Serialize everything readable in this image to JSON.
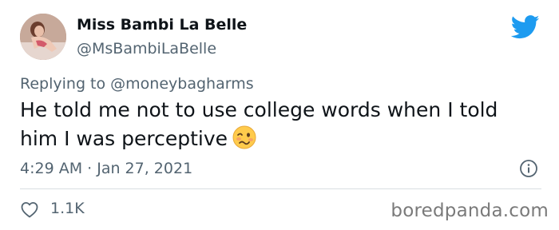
{
  "author": {
    "display_name": "Miss Bambi La Belle",
    "handle": "@MsBambiLaBelle"
  },
  "reply": {
    "prefix": "Replying to ",
    "mention": "@moneybagharms"
  },
  "tweet": {
    "text": "He told me not to use college words when I told him I was perceptive",
    "emoji": "woozy-face-icon"
  },
  "meta": {
    "timestamp": "4:29 AM · Jan 27, 2021"
  },
  "engagement": {
    "likes": "1.1K"
  },
  "watermark": "boredpanda.com",
  "colors": {
    "twitter_blue": "#1d9bf0",
    "secondary_text": "#536471",
    "primary_text": "#0f1419"
  }
}
